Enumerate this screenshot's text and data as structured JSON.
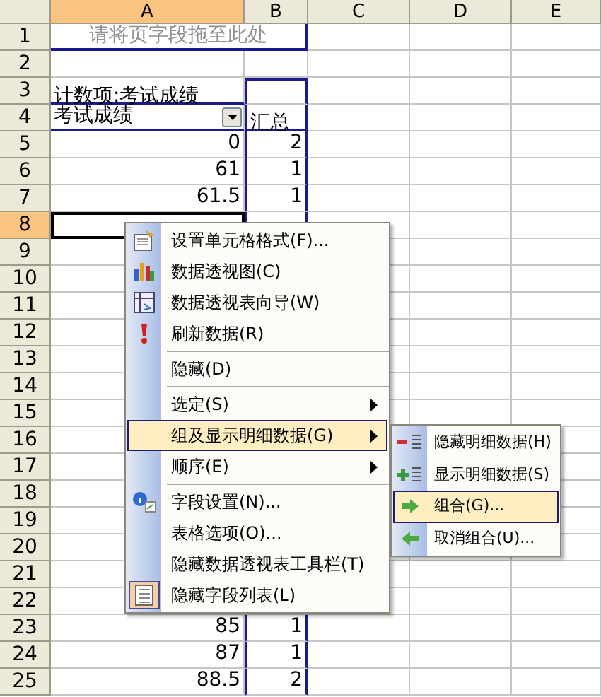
{
  "columns": [
    {
      "label": "A",
      "selected": true
    },
    {
      "label": "B",
      "selected": false
    },
    {
      "label": "C",
      "selected": false
    },
    {
      "label": "D",
      "selected": false
    },
    {
      "label": "E",
      "selected": false
    }
  ],
  "rows": [
    {
      "number": "1",
      "selected": false,
      "kind": "page_field",
      "text": "请将页字段拖至此处"
    },
    {
      "number": "2",
      "selected": false,
      "kind": "empty"
    },
    {
      "number": "3",
      "selected": false,
      "kind": "data_title",
      "text": "计数项:考试成绩"
    },
    {
      "number": "4",
      "selected": false,
      "kind": "field_header",
      "text": "考试成绩",
      "total": "汇总"
    },
    {
      "number": "5",
      "selected": false,
      "kind": "value",
      "value": "0",
      "count": "2"
    },
    {
      "number": "6",
      "selected": false,
      "kind": "value",
      "value": "61",
      "count": "1"
    },
    {
      "number": "7",
      "selected": false,
      "kind": "value",
      "value": "61.5",
      "count": "1"
    },
    {
      "number": "8",
      "selected": true,
      "kind": "value"
    },
    {
      "number": "9",
      "selected": false,
      "kind": "value"
    },
    {
      "number": "10",
      "selected": false,
      "kind": "value"
    },
    {
      "number": "11",
      "selected": false,
      "kind": "value"
    },
    {
      "number": "12",
      "selected": false,
      "kind": "value"
    },
    {
      "number": "13",
      "selected": false,
      "kind": "value"
    },
    {
      "number": "14",
      "selected": false,
      "kind": "value"
    },
    {
      "number": "15",
      "selected": false,
      "kind": "value"
    },
    {
      "number": "16",
      "selected": false,
      "kind": "value"
    },
    {
      "number": "17",
      "selected": false,
      "kind": "value"
    },
    {
      "number": "18",
      "selected": false,
      "kind": "value"
    },
    {
      "number": "19",
      "selected": false,
      "kind": "value"
    },
    {
      "number": "20",
      "selected": false,
      "kind": "value"
    },
    {
      "number": "21",
      "selected": false,
      "kind": "value"
    },
    {
      "number": "22",
      "selected": false,
      "kind": "value"
    },
    {
      "number": "23",
      "selected": false,
      "kind": "value",
      "value": "85",
      "count": "1"
    },
    {
      "number": "24",
      "selected": false,
      "kind": "value",
      "value": "87",
      "count": "1"
    },
    {
      "number": "25",
      "selected": false,
      "kind": "value",
      "value": "88.5",
      "count": "2"
    }
  ],
  "context_menu": [
    {
      "kind": "item",
      "label": "设置单元格格式(F)...",
      "submenu": false,
      "selected": false,
      "checked": false
    },
    {
      "kind": "item",
      "label": "数据透视图(C)",
      "submenu": false,
      "selected": false,
      "checked": false
    },
    {
      "kind": "item",
      "label": "数据透视表向导(W)",
      "submenu": false,
      "selected": false,
      "checked": false
    },
    {
      "kind": "item",
      "label": "刷新数据(R)",
      "submenu": false,
      "selected": false,
      "checked": false
    },
    {
      "kind": "separator"
    },
    {
      "kind": "item",
      "label": "隐藏(D)",
      "submenu": false,
      "selected": false,
      "checked": false
    },
    {
      "kind": "separator"
    },
    {
      "kind": "item",
      "label": "选定(S)",
      "submenu": true,
      "selected": false,
      "checked": false
    },
    {
      "kind": "item",
      "label": "组及显示明细数据(G)",
      "submenu": true,
      "selected": true,
      "checked": false
    },
    {
      "kind": "item",
      "label": "顺序(E)",
      "submenu": true,
      "selected": false,
      "checked": false
    },
    {
      "kind": "separator"
    },
    {
      "kind": "item",
      "label": "字段设置(N)...",
      "submenu": false,
      "selected": false,
      "checked": false
    },
    {
      "kind": "item",
      "label": "表格选项(O)...",
      "submenu": false,
      "selected": false,
      "checked": false
    },
    {
      "kind": "item",
      "label": "隐藏数据透视表工具栏(T)",
      "submenu": false,
      "selected": false,
      "checked": false
    },
    {
      "kind": "item",
      "label": "隐藏字段列表(L)",
      "submenu": false,
      "selected": false,
      "checked": true
    }
  ],
  "submenu": [
    {
      "label": "隐藏明细数据(H)",
      "selected": false
    },
    {
      "label": "显示明细数据(S)",
      "selected": false
    },
    {
      "label": "组合(G)...",
      "selected": true
    },
    {
      "label": "取消组合(U)...",
      "selected": false
    }
  ]
}
